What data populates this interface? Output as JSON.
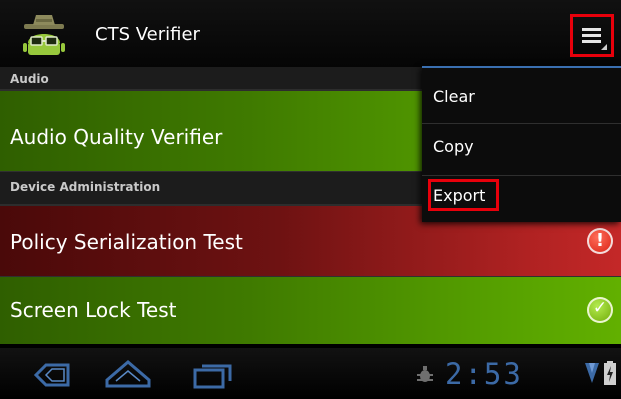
{
  "app": {
    "title": "CTS Verifier",
    "icon": "android-verifier-icon"
  },
  "actionbar": {
    "overflow_icon": "overflow-menu-icon",
    "overflow_highlighted": true
  },
  "sections": [
    {
      "header": "Audio",
      "tests": [
        {
          "label": "Audio Quality Verifier",
          "status": "untested"
        }
      ]
    },
    {
      "header": "Device Administration",
      "tests": [
        {
          "label": "Policy Serialization Test",
          "status": "failed",
          "status_icon": "warning-icon",
          "status_glyph": "!"
        },
        {
          "label": "Screen Lock Test",
          "status": "passed",
          "status_icon": "check-icon",
          "status_glyph": "✓"
        }
      ]
    }
  ],
  "menu": {
    "items": [
      {
        "label": "Clear"
      },
      {
        "label": "Copy"
      },
      {
        "label": "Export",
        "highlighted": true
      }
    ]
  },
  "system_bar": {
    "buttons": [
      "back-icon",
      "home-icon",
      "recent-apps-icon"
    ],
    "notification_icon": "debug-bug-icon",
    "time": "2:53",
    "wifi_icon": "wifi-icon",
    "battery_icon": "battery-charging-icon"
  },
  "colors": {
    "pass_row": "#56a000",
    "fail_row": "#b02222",
    "highlight_border": "#e8000b",
    "clock": "#3c6aa6"
  }
}
